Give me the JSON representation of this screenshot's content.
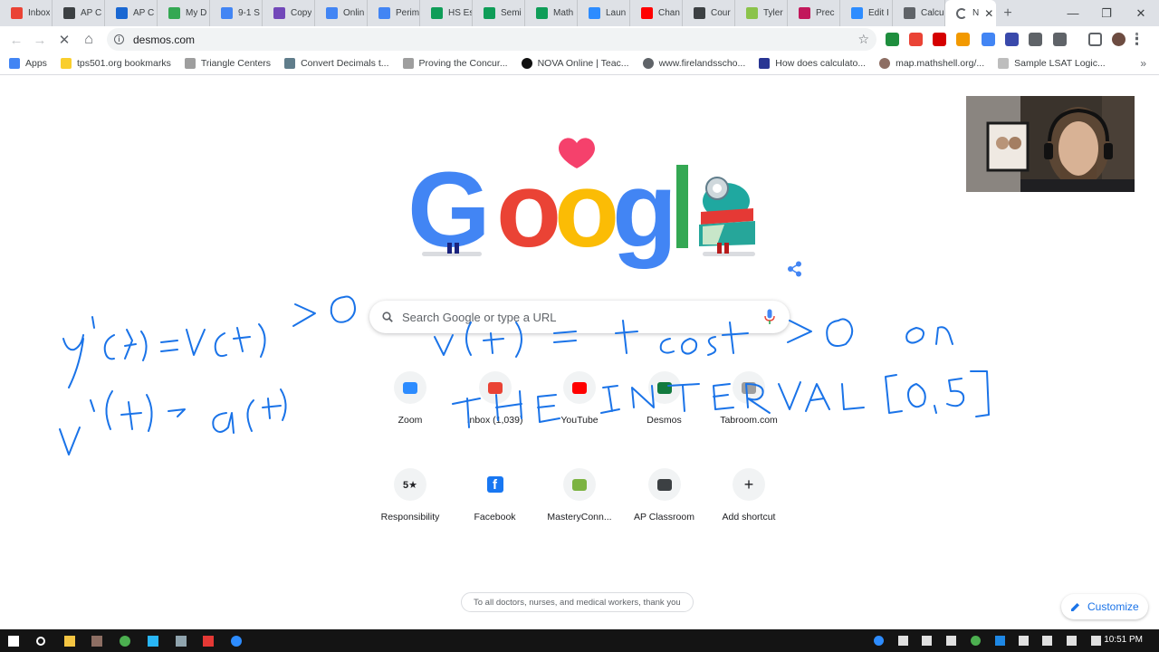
{
  "colors": {
    "tabstrip_bg": "#dee1e6",
    "accent": "#1a73e8",
    "ink": "#1a73e8",
    "doodle_heart": "#f5416c",
    "google_blue": "#4285f4",
    "google_red": "#ea4335",
    "google_yellow": "#fbbc05",
    "google_green": "#34a853",
    "taskbar_bg": "#141414"
  },
  "tabs": [
    {
      "label": "Inbox",
      "icon": "gmail-icon",
      "color": "#ea4335"
    },
    {
      "label": "AP C",
      "icon": "shield-icon",
      "color": "#3c4043"
    },
    {
      "label": "AP C",
      "icon": "classroom-icon",
      "color": "#1967d2"
    },
    {
      "label": "My D",
      "icon": "drive-icon",
      "color": "#34a853"
    },
    {
      "label": "9-1 S",
      "icon": "docs-icon",
      "color": "#4285f4"
    },
    {
      "label": "Copy",
      "icon": "forms-icon",
      "color": "#7248b9"
    },
    {
      "label": "Onlin",
      "icon": "docs-icon",
      "color": "#4285f4"
    },
    {
      "label": "Perim",
      "icon": "docs-icon",
      "color": "#4285f4"
    },
    {
      "label": "HS Es",
      "icon": "sheets-icon",
      "color": "#0f9d58"
    },
    {
      "label": "Semi",
      "icon": "sheets-icon",
      "color": "#0f9d58"
    },
    {
      "label": "Math",
      "icon": "sheets-icon",
      "color": "#0f9d58"
    },
    {
      "label": "Laun",
      "icon": "zoom-icon",
      "color": "#2d8cff"
    },
    {
      "label": "Chan",
      "icon": "youtube-icon",
      "color": "#ff0000"
    },
    {
      "label": "Cour",
      "icon": "shield-icon",
      "color": "#3c4043"
    },
    {
      "label": "Tyler",
      "icon": "tyler-icon",
      "color": "#8bc34a"
    },
    {
      "label": "Prec",
      "icon": "classroom-icon",
      "color": "#c2185b"
    },
    {
      "label": "Edit I",
      "icon": "zoom-icon",
      "color": "#2d8cff"
    },
    {
      "label": "Calcu",
      "icon": "globe-icon",
      "color": "#5f6368"
    }
  ],
  "active_tab": {
    "label": "N",
    "close": "✕"
  },
  "window": {
    "minimize": "—",
    "maximize": "❐",
    "close": "✕",
    "new_tab": "+"
  },
  "address": {
    "url": "desmos.com",
    "info": "i",
    "star": "☆"
  },
  "nav": {
    "back": "←",
    "forward": "→",
    "stop": "✕",
    "home": "⌂"
  },
  "extensions": [
    {
      "icon": "classroom-ext-icon",
      "color": "#1e8e3e"
    },
    {
      "icon": "arrow-ext-icon",
      "color": "#ea4335"
    },
    {
      "icon": "opera-ext-icon",
      "color": "#d50000"
    },
    {
      "icon": "trophy-ext-icon",
      "color": "#f29900"
    },
    {
      "icon": "diamond-ext-icon",
      "color": "#4285f4"
    },
    {
      "icon": "c-ext-icon",
      "color": "#3949ab"
    },
    {
      "icon": "gear-ext-icon",
      "color": "#5f6368"
    },
    {
      "icon": "puzzle-ext-icon",
      "color": "#5f6368"
    },
    {
      "icon": "cast-icon",
      "color": "#5f6368"
    },
    {
      "icon": "profile-avatar-icon",
      "color": "#6d4c41"
    },
    {
      "icon": "menu-dots-icon",
      "color": "#5f6368"
    }
  ],
  "bookmarks": [
    {
      "label": "Apps",
      "icon": "apps-grid-icon",
      "color": "#4285f4"
    },
    {
      "label": "tps501.org bookmarks",
      "icon": "folder-icon",
      "color": "#f9ce2d"
    },
    {
      "label": "Triangle Centers",
      "icon": "page-icon",
      "color": "#9e9e9e"
    },
    {
      "label": "Convert Decimals t...",
      "icon": "bird-icon",
      "color": "#607d8b"
    },
    {
      "label": "Proving the Concur...",
      "icon": "page-icon",
      "color": "#9e9e9e"
    },
    {
      "label": "NOVA Online | Teac...",
      "icon": "nova-icon",
      "color": "#111111"
    },
    {
      "label": "www.firelandsscho...",
      "icon": "globe-icon",
      "color": "#5f6368"
    },
    {
      "label": "How does calculato...",
      "icon": "calc-icon",
      "color": "#283593"
    },
    {
      "label": "map.mathshell.org/...",
      "icon": "shell-icon",
      "color": "#8d6e63"
    },
    {
      "label": "Sample LSAT Logic...",
      "icon": "page-icon",
      "color": "#bdbdbd"
    }
  ],
  "bookmarks_more": "»",
  "search": {
    "placeholder": "Search Google or type a URL"
  },
  "shortcuts": [
    {
      "label": "Zoom",
      "icon": "zoom-icon",
      "color": "#2d8cff"
    },
    {
      "label": "Inbox (1,039)",
      "icon": "gmail-icon",
      "color": "#ea4335"
    },
    {
      "label": "YouTube",
      "icon": "youtube-icon",
      "color": "#ff0000"
    },
    {
      "label": "Desmos",
      "icon": "desmos-icon",
      "color": "#127a3e"
    },
    {
      "label": "Tabroom.com",
      "icon": "tabroom-icon",
      "color": "#9e9e9e"
    },
    {
      "label": "Responsibility",
      "icon": "five-star-icon",
      "color": "#202124",
      "glyph": "5★"
    },
    {
      "label": "Facebook",
      "icon": "facebook-icon",
      "color": "#1877f2",
      "glyph": "f"
    },
    {
      "label": "MasteryConn...",
      "icon": "mastery-connect-icon",
      "color": "#7cb342"
    },
    {
      "label": "AP Classroom",
      "icon": "shield-icon",
      "color": "#3c4043"
    },
    {
      "label": "Add shortcut",
      "icon": "plus-icon",
      "color": "#202124",
      "glyph": "+"
    }
  ],
  "footer_message": "To all doctors, nurses, and medical workers, thank you",
  "customize": {
    "label": "Customize",
    "icon": "pencil-icon"
  },
  "taskbar": {
    "time": "10:51 PM",
    "icons": [
      "windows-start-icon",
      "search-icon",
      "file-explorer-icon",
      "app-icon",
      "chrome-icon",
      "app-icon",
      "app-icon",
      "acrobat-icon",
      "zoom-icon"
    ],
    "tray": [
      "zoom-icon",
      "tray-icon",
      "tray-icon",
      "tray-icon",
      "chrome-icon",
      "bluetooth-icon",
      "battery-icon",
      "volume-icon",
      "wifi-icon",
      "pen-icon"
    ]
  },
  "handwriting_color": "#1a73e8"
}
